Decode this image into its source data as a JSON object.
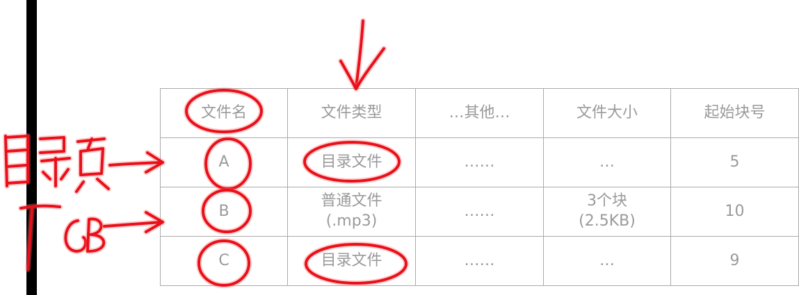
{
  "table": {
    "headers": [
      "文件名",
      "文件类型",
      "…其他…",
      "文件大小",
      "起始块号"
    ],
    "rows": [
      {
        "name": "A",
        "type": "目录文件",
        "other": "……",
        "size": "…",
        "start": "5"
      },
      {
        "name": "B",
        "type": "普通文件\n(.mp3)",
        "other": "……",
        "size": "3个块\n(2.5KB)",
        "start": "10"
      },
      {
        "name": "C",
        "type": "目录文件",
        "other": "……",
        "size": "…",
        "start": "9"
      }
    ]
  },
  "annotations": {
    "ink_color": "#e8101a",
    "handwritten_note_row_a": "目录项",
    "handwritten_note_row_b": "FCB"
  }
}
